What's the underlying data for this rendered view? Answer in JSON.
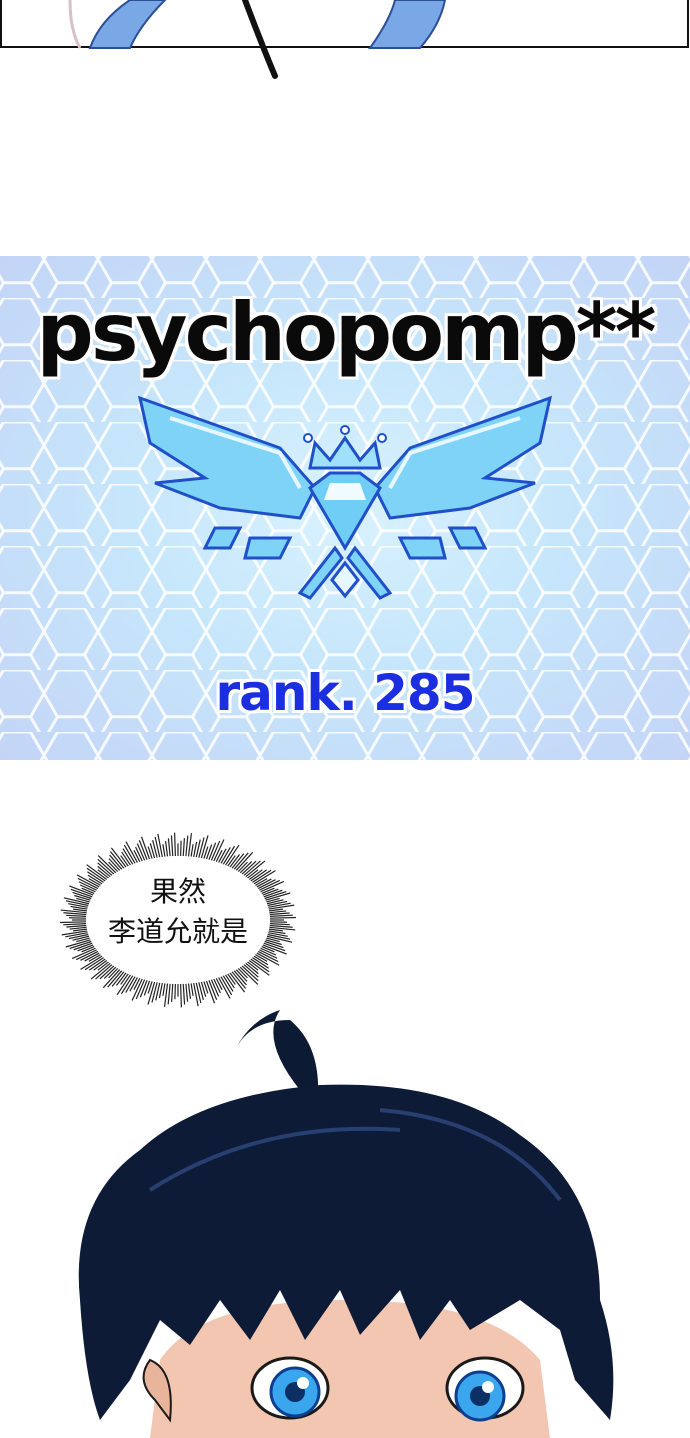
{
  "rank_card": {
    "player_name": "psychopomp**",
    "rank_label": "rank. 285",
    "emblem_icon": "winged-diamond-crown-emblem",
    "colors": {
      "name_text": "#0a0a0a",
      "rank_text": "#1b2fe0",
      "background": "#c6e6fb",
      "emblem": "#5ec8f5"
    }
  },
  "speech": {
    "line1": "果然",
    "line2": "李道允就是"
  },
  "art": {
    "top_panel": "partial-character-illustration",
    "bottom_panel": "dark-haired-boy-blue-eyes"
  }
}
